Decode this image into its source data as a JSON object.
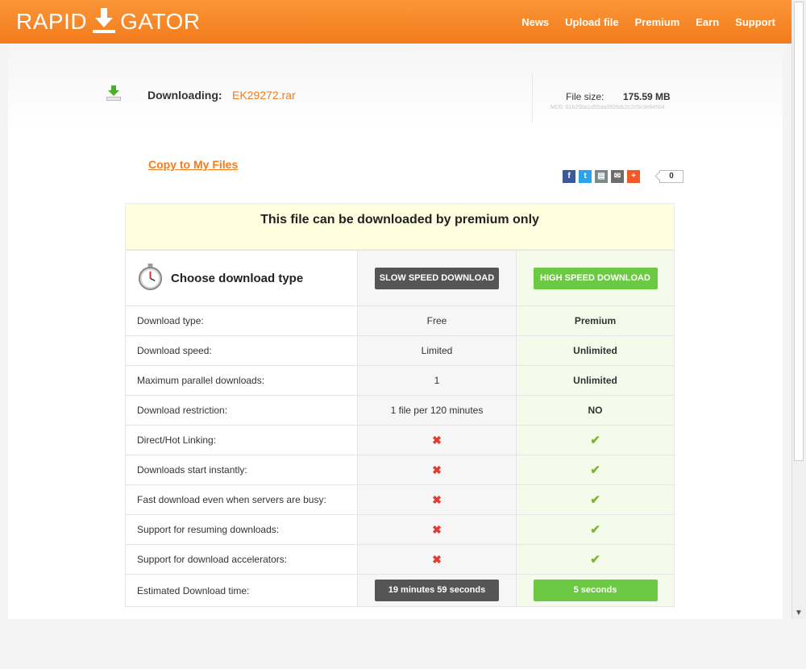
{
  "brand": {
    "left": "RAPID",
    "right": "GATOR",
    "accent": "#f37b1c"
  },
  "nav": [
    "News",
    "Upload file",
    "Premium",
    "Earn",
    "Support"
  ],
  "file": {
    "downloading_label": "Downloading:",
    "name": "EK29272.rar",
    "size_label": "File size:",
    "size": "175.59 MB",
    "md5": "MD5: 01b25ba1d55aa3926dc2c2c5c3e84504"
  },
  "copy_link": "Copy to My Files",
  "share": {
    "icons": [
      "facebook-icon",
      "twitter-icon",
      "print-icon",
      "email-icon",
      "plus-icon"
    ],
    "count": "0"
  },
  "notice": "This file can be downloaded by premium only",
  "table": {
    "choose_label": "Choose download type",
    "slow_button": "SLOW SPEED DOWNLOAD",
    "fast_button": "HIGH SPEED DOWNLOAD",
    "rows": [
      {
        "label": "Download type:",
        "free": "Free",
        "premium": "Premium"
      },
      {
        "label": "Download speed:",
        "free": "Limited",
        "premium": "Unlimited"
      },
      {
        "label": "Maximum parallel downloads:",
        "free": "1",
        "premium": "Unlimited"
      },
      {
        "label": "Download restriction:",
        "free": "1 file per 120 minutes",
        "premium": "NO"
      },
      {
        "label": "Direct/Hot Linking:",
        "free": "✖",
        "premium": "✔"
      },
      {
        "label": "Downloads start instantly:",
        "free": "✖",
        "premium": "✔"
      },
      {
        "label": "Fast download even when servers are busy:",
        "free": "✖",
        "premium": "✔"
      },
      {
        "label": "Support for resuming downloads:",
        "free": "✖",
        "premium": "✔"
      },
      {
        "label": "Support for download accelerators:",
        "free": "✖",
        "premium": "✔"
      }
    ],
    "time_label": "Estimated Download time:",
    "time_free": "19 minutes 59 seconds",
    "time_premium": "5 seconds"
  }
}
